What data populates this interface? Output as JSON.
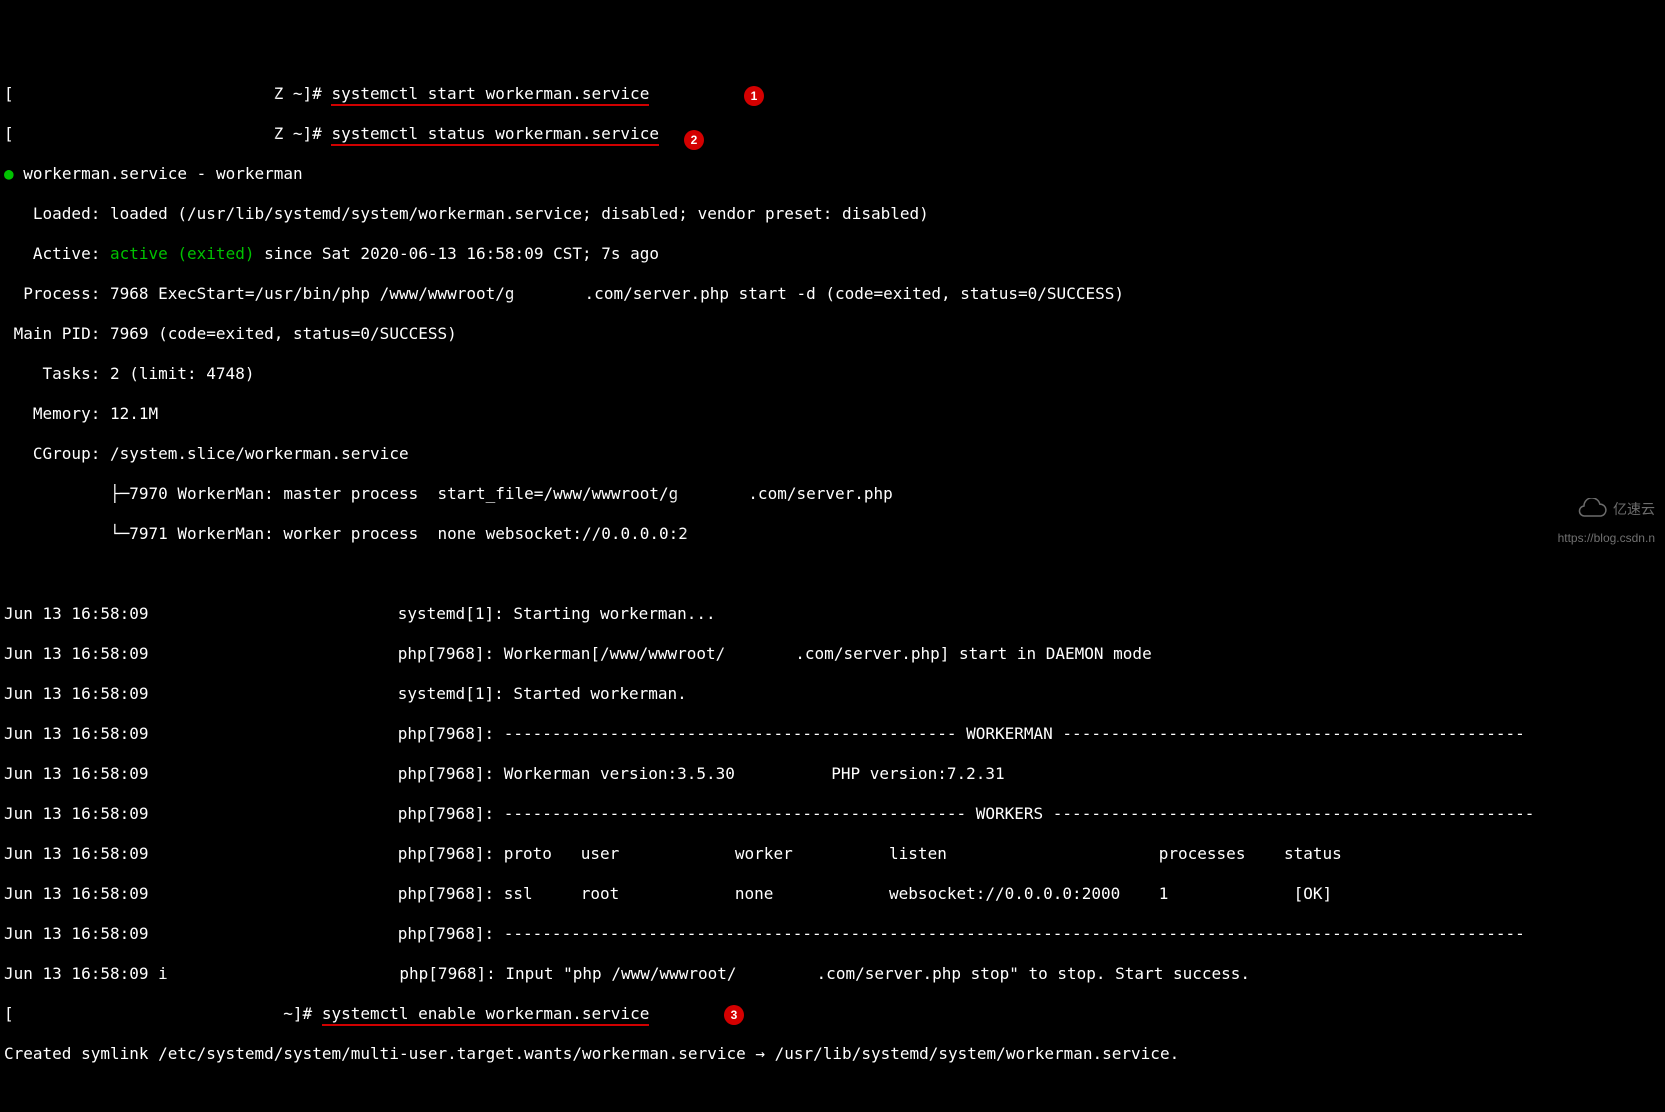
{
  "prompt_suffix": "Z ~]# ",
  "cmds": {
    "start": "systemctl start workerman.service",
    "status": "systemctl status workerman.service",
    "enable": "systemctl enable workerman.service"
  },
  "badges": {
    "b1": "1",
    "b2": "2",
    "b3": "3"
  },
  "unit_header": {
    "bullet": "●",
    "name": "workerman.service - workerman"
  },
  "status": {
    "loaded": "   Loaded: loaded (/usr/lib/systemd/system/workerman.service; disabled; vendor preset: disabled)",
    "active_lbl": "   Active: ",
    "active_val": "active (exited)",
    "active_since": " since Sat 2020-06-13 16:58:09 CST; 7s ago",
    "process_pre": "  Process: 7968 ExecStart=/usr/bin/php /www/wwwroot/g",
    "process_post": ".com/server.php start -d (code=exited, status=0/SUCCESS)",
    "main_pid": " Main PID: 7969 (code=exited, status=0/SUCCESS)",
    "tasks": "    Tasks: 2 (limit: 4748)",
    "memory": "   Memory: 12.1M",
    "cgroup": "   CGroup: /system.slice/workerman.service",
    "tree1_pre": "           ├─7970 WorkerMan: master process  start_file=/www/wwwroot/g",
    "tree1_post": ".com/server.php",
    "tree2": "           └─7971 WorkerMan: worker process  none websocket://0.0.0.0:2"
  },
  "log": {
    "ts": "Jun 13 16:58:09 ",
    "l1": " systemd[1]: Starting workerman...",
    "l2_pre": " php[7968]: Workerman[/www/wwwroot/",
    "l2_post": ".com/server.php] start in DAEMON mode",
    "l3": " systemd[1]: Started workerman.",
    "l4": " php[7968]: ----------------------------------------------- WORKERMAN ------------------------------------------------",
    "l5": " php[7968]: Workerman version:3.5.30          PHP version:7.2.31",
    "l6": " php[7968]: ------------------------------------------------ WORKERS --------------------------------------------------",
    "l7": " php[7968]: proto   user            worker          listen                      processes    status",
    "l8": " php[7968]: ssl     root            none            websocket://0.0.0.0:2000    1             [OK]",
    "l9": " php[7968]: ----------------------------------------------------------------------------------------------------------",
    "l10_pre": " php[7968]: Input \"php /www/wwwroot/",
    "l10_post": ".com/server.php stop\" to stop. Start success."
  },
  "enable_result": "Created symlink /etc/systemd/system/multi-user.target.wants/workerman.service → /usr/lib/systemd/system/workerman.service.",
  "watermark": "https://blog.csdn.n",
  "cloud_label": "亿速云"
}
